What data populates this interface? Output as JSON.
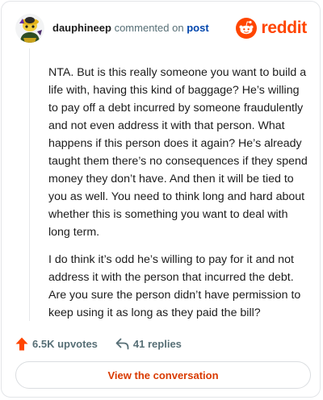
{
  "header": {
    "username": "dauphineep",
    "commented_on": "commented on",
    "post_link": "post",
    "brand": "reddit",
    "avatar_icon": "snoo-avatar-icon",
    "brand_icon": "reddit-logo-icon"
  },
  "comment": {
    "paragraphs": [
      "NTA. But is this really someone you want to build a life with, having this kind of baggage? He’s willing to pay off a debt incurred by someone fraudulently and not even address it with that person. What happens if this person does it again? He’s already taught them there’s no consequences if they spend money they don’t have. And then it will be tied to you as well. You need to think long and hard about whether this is something you want to deal with long term.",
      "I do think it’s odd he’s willing to pay for it and not address it with the person that incurred the debt. Are you sure the person didn’t have permission to keep using it as long as they paid the bill?"
    ]
  },
  "actions": {
    "upvotes": "6.5K upvotes",
    "replies": "41 replies",
    "upvote_icon": "upvote-arrow-icon",
    "reply_icon": "reply-arrow-icon"
  },
  "cta": {
    "label": "View the conversation"
  },
  "colors": {
    "brand": "#ff4500",
    "link": "#0045ac",
    "cta": "#d93a00",
    "muted": "#576f76"
  }
}
